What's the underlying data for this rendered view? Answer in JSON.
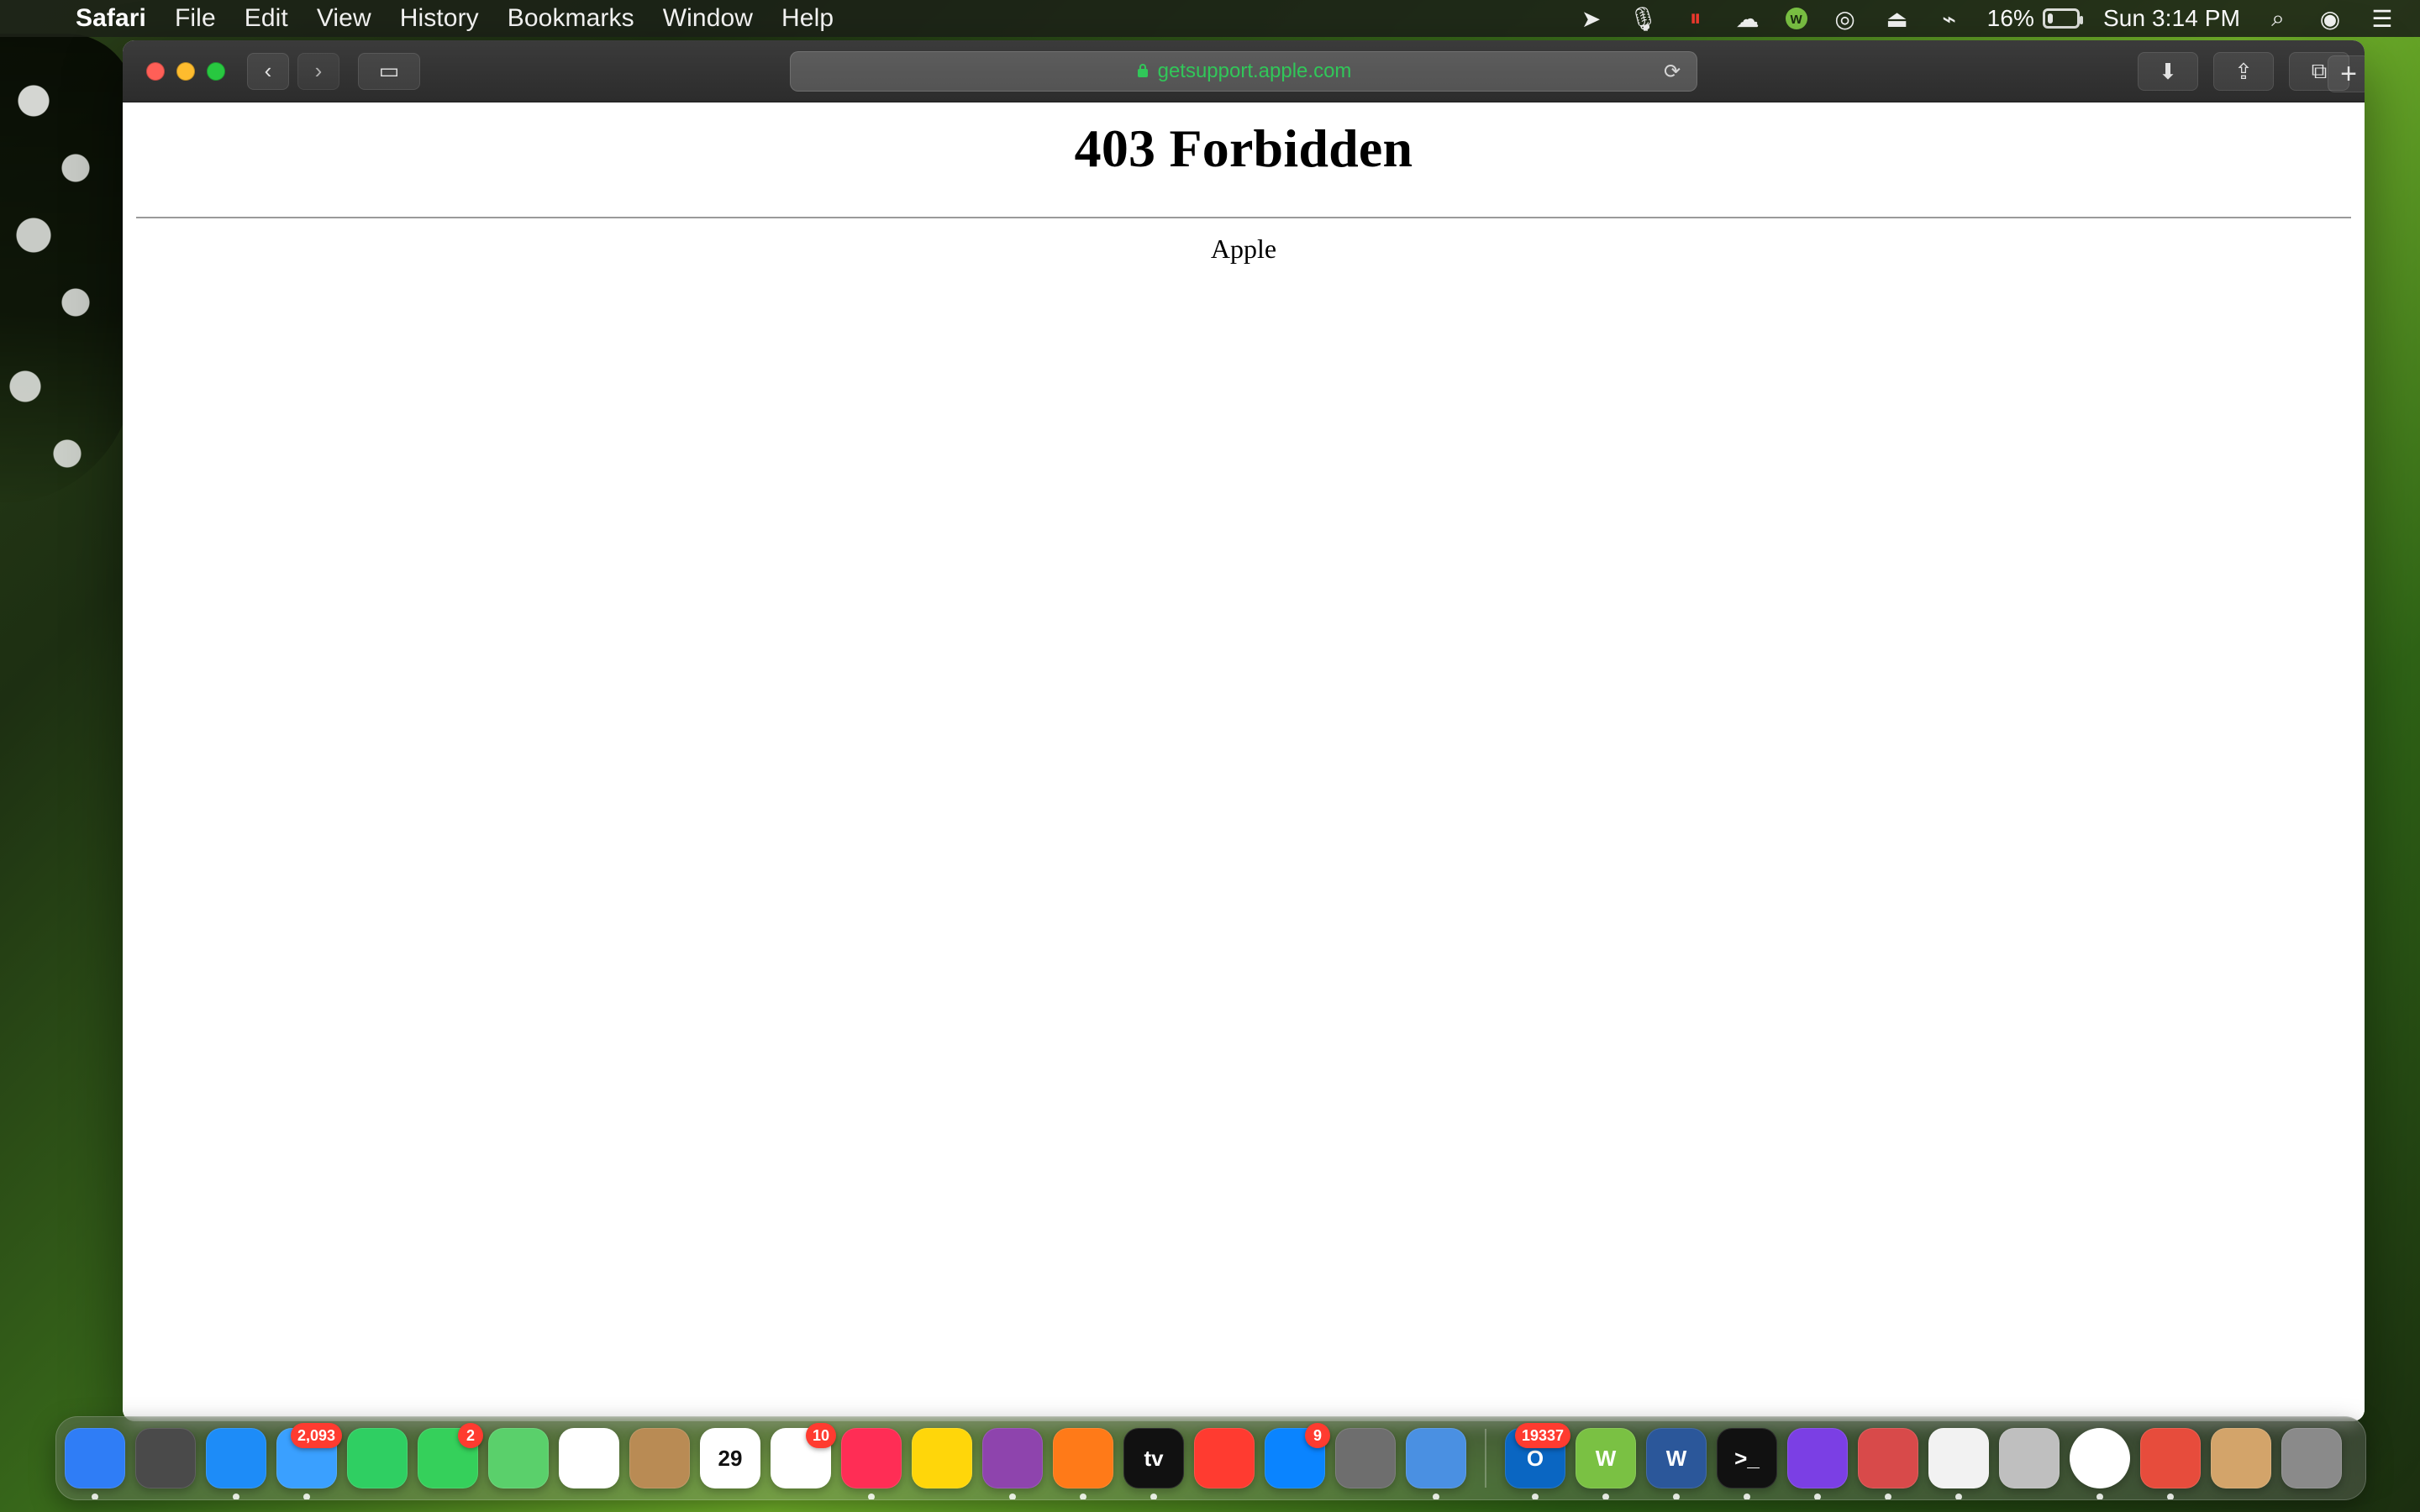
{
  "menubar": {
    "app_name": "Safari",
    "items": [
      "File",
      "Edit",
      "View",
      "History",
      "Bookmarks",
      "Window",
      "Help"
    ],
    "status": {
      "battery_percent": "16%",
      "battery_level": 0.16,
      "time": "Sun 3:14 PM"
    }
  },
  "browser": {
    "address": "getsupport.apple.com"
  },
  "page": {
    "title": "403 Forbidden",
    "footer": "Apple"
  },
  "dock": {
    "icons": [
      {
        "name": "finder-icon",
        "bg": "#2f7df6",
        "label": "",
        "badge": "",
        "running": true
      },
      {
        "name": "launchpad-icon",
        "bg": "#4a4a4a",
        "label": "",
        "badge": "",
        "running": false
      },
      {
        "name": "safari-icon",
        "bg": "#1d8cf8",
        "label": "",
        "badge": "",
        "running": true
      },
      {
        "name": "mail-icon",
        "bg": "#3aa0ff",
        "label": "",
        "badge": "2,093",
        "running": true
      },
      {
        "name": "facetime-icon",
        "bg": "#2fcf62",
        "label": "",
        "badge": "",
        "running": false
      },
      {
        "name": "messages-icon",
        "bg": "#35d05b",
        "label": "",
        "badge": "2",
        "running": false
      },
      {
        "name": "maps-icon",
        "bg": "#5ad06b",
        "label": "",
        "badge": "",
        "running": false
      },
      {
        "name": "photos-icon",
        "bg": "#ffffff",
        "label": "",
        "badge": "",
        "running": false
      },
      {
        "name": "contacts-icon",
        "bg": "#b98b54",
        "label": "",
        "badge": "",
        "running": false
      },
      {
        "name": "calendar-icon",
        "bg": "#ffffff",
        "label": "29",
        "badge": "",
        "running": false
      },
      {
        "name": "reminders-icon",
        "bg": "#ffffff",
        "label": "",
        "badge": "10",
        "running": false
      },
      {
        "name": "music-icon",
        "bg": "#ff2d55",
        "label": "",
        "badge": "",
        "running": true
      },
      {
        "name": "notes-icon",
        "bg": "#ffd60a",
        "label": "",
        "badge": "",
        "running": false
      },
      {
        "name": "podcasts-icon",
        "bg": "#8e44ad",
        "label": "",
        "badge": "",
        "running": true
      },
      {
        "name": "firefox-icon",
        "bg": "#ff7a18",
        "label": "",
        "badge": "",
        "running": true
      },
      {
        "name": "apple-tv-icon",
        "bg": "#111111",
        "label": "tv",
        "badge": "",
        "running": true
      },
      {
        "name": "news-icon",
        "bg": "#ff3b30",
        "label": "",
        "badge": "",
        "running": false
      },
      {
        "name": "app-store-icon",
        "bg": "#0a84ff",
        "label": "",
        "badge": "9",
        "running": false
      },
      {
        "name": "system-preferences-icon",
        "bg": "#6e6e6e",
        "label": "",
        "badge": "",
        "running": false
      },
      {
        "name": "remote-desktop-icon",
        "bg": "#4a90e2",
        "label": "",
        "badge": "",
        "running": true
      },
      {
        "name": "outlook-icon",
        "bg": "#0a66c2",
        "label": "O",
        "badge": "19337",
        "running": true
      },
      {
        "name": "wunderlist-icon",
        "bg": "#7ac143",
        "label": "W",
        "badge": "",
        "running": true
      },
      {
        "name": "word-icon",
        "bg": "#2b579a",
        "label": "W",
        "badge": "",
        "running": true
      },
      {
        "name": "terminal-icon",
        "bg": "#111111",
        "label": ">_",
        "badge": "",
        "running": true
      },
      {
        "name": "imovie-icon",
        "bg": "#7b3fe4",
        "label": "",
        "badge": "",
        "running": true
      },
      {
        "name": "bear-icon",
        "bg": "#d84a4a",
        "label": "",
        "badge": "",
        "running": true
      },
      {
        "name": "prism-icon",
        "bg": "#f2f2f2",
        "label": "",
        "badge": "",
        "running": true
      },
      {
        "name": "rocket-icon",
        "bg": "#bfbfbf",
        "label": "",
        "badge": "",
        "running": false
      },
      {
        "name": "chrome-icon",
        "bg": "#ffffff",
        "label": "",
        "badge": "",
        "running": true
      },
      {
        "name": "anydesk-icon",
        "bg": "#e74c3c",
        "label": "",
        "badge": "",
        "running": true
      },
      {
        "name": "archive-utility-icon",
        "bg": "#d3a46a",
        "label": "",
        "badge": "",
        "running": false
      },
      {
        "name": "trash-icon",
        "bg": "#8a8a8a",
        "label": "",
        "badge": "",
        "running": false
      }
    ]
  }
}
